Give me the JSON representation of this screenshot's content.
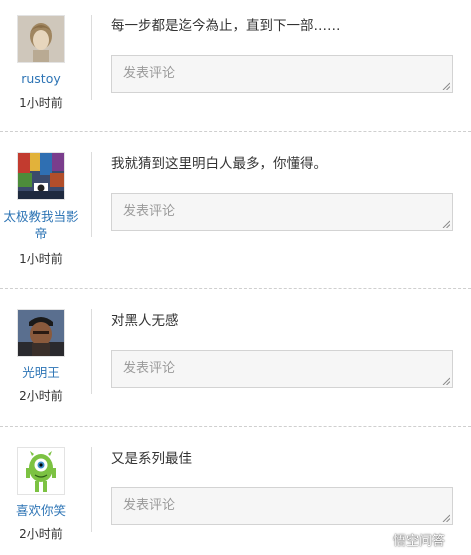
{
  "placeholder": "发表评论",
  "comments": [
    {
      "user": "rustoy",
      "time": "1小时前",
      "text": "每一步都是迄今為止，直到下一部……"
    },
    {
      "user": "太极教我当影帝",
      "time": "1小时前",
      "text": "我就猜到这里明白人最多，你懂得。"
    },
    {
      "user": "光明王",
      "time": "2小时前",
      "text": "对黑人无感"
    },
    {
      "user": "喜欢你笑",
      "time": "2小时前",
      "text": "又是系列最佳"
    }
  ],
  "watermark": "悟空问答",
  "colors": {
    "link": "#2d74b5",
    "text": "#333333",
    "placeholder": "#9a9a9a",
    "box_bg": "#f6f6f6",
    "box_border": "#d3d3d3"
  }
}
